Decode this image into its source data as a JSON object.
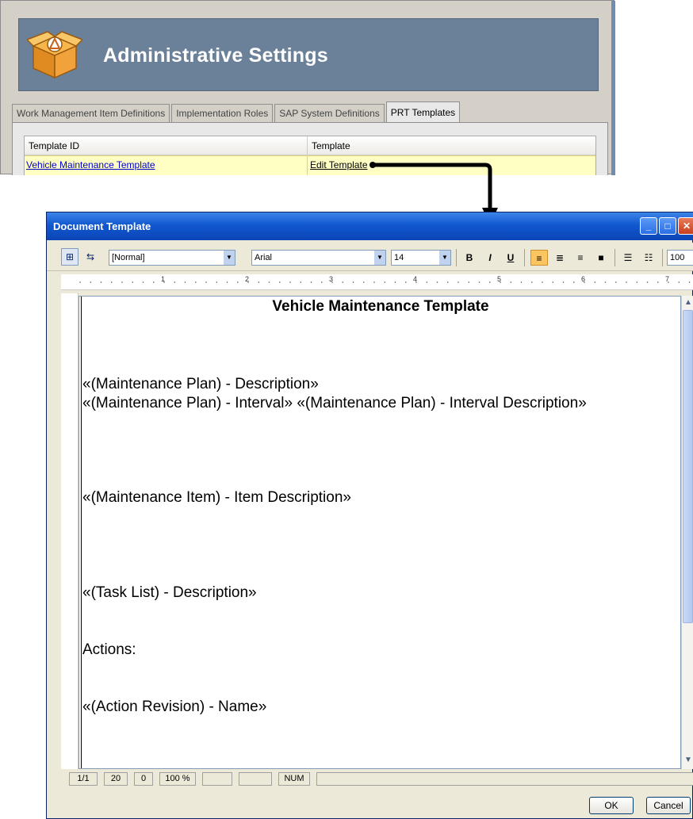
{
  "admin": {
    "title": "Administrative Settings",
    "tabs": [
      {
        "label": "Work Management Item Definitions"
      },
      {
        "label": "Implementation Roles"
      },
      {
        "label": "SAP System Definitions"
      },
      {
        "label": "PRT Templates",
        "active": true
      }
    ],
    "grid": {
      "headers": [
        "Template ID",
        "Template"
      ],
      "rows": [
        {
          "template_id": "Vehicle Maintenance Template",
          "template": "Edit Template"
        }
      ]
    }
  },
  "dialog": {
    "title": "Document Template",
    "toolbar": {
      "style": "[Normal]",
      "font": "Arial",
      "size": "14",
      "bold": "B",
      "italic": "I",
      "underline": "U",
      "zoom_partial": "100"
    },
    "ruler_marks": [
      "1",
      "2",
      "3",
      "4",
      "5",
      "6",
      "7"
    ],
    "document": {
      "title": "Vehicle Maintenance Template",
      "lines": [
        "«(Maintenance Plan) - Description»",
        "«(Maintenance Plan) - Interval» «(Maintenance Plan) - Interval Description»",
        "«(Maintenance Item) - Item Description»",
        "«(Task List) - Description»",
        "Actions:",
        "«(Action Revision) - Name»"
      ]
    },
    "status": {
      "page": "1/1",
      "line": "20",
      "col": "0",
      "zoom": "100 %",
      "num": "NUM"
    },
    "buttons": {
      "ok": "OK",
      "cancel": "Cancel"
    }
  },
  "colors": {
    "header_blue": "#6b8199",
    "title_bar": "#1157d0",
    "row_highlight": "#ffffc4",
    "link": "#0000cc"
  }
}
